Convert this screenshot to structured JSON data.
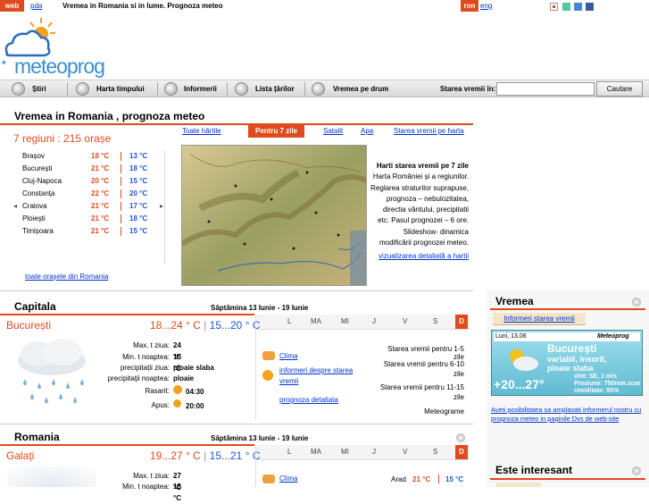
{
  "topbar": {
    "tab_web": "web",
    "tab_pda": "pda",
    "slogan": "Vremea in Romania si in lume. Prognoza meteo",
    "lang_active": "ron",
    "lang_other": "eng",
    "swatch_colors": [
      "#ffffff",
      "#52c7a0",
      "#4a86d8",
      "#345c9c"
    ]
  },
  "logo": {
    "text": "meteoprog"
  },
  "nav": {
    "items": [
      {
        "label": "Știri",
        "icon": "news-icon"
      },
      {
        "label": "Harta timpului",
        "icon": "map-icon"
      },
      {
        "label": "Informerii",
        "icon": "informer-icon"
      },
      {
        "label": "Lista țărilor",
        "icon": "globe-icon"
      },
      {
        "label": "Vremea pe drum",
        "icon": "car-icon"
      }
    ],
    "search_label": "Starea vremii în:",
    "search_value": "",
    "search_button": "Cautare"
  },
  "main": {
    "title": "Vremea in Romania , prognoza meteo",
    "regions": "7 regiuni : 215 orașe",
    "cities": [
      {
        "name": "Brașov",
        "high": "18 °C",
        "low": "13 °C"
      },
      {
        "name": "București",
        "high": "21 °C",
        "low": "18 °C"
      },
      {
        "name": "Cluj-Napoca",
        "high": "20 °C",
        "low": "15 °C"
      },
      {
        "name": "Constanța",
        "high": "22 °C",
        "low": "20 °C"
      },
      {
        "name": "Craiova",
        "high": "21 °C",
        "low": "17 °C"
      },
      {
        "name": "Ploiești",
        "high": "21 °C",
        "low": "18 °C"
      },
      {
        "name": "Timișoara",
        "high": "21 °C",
        "low": "15 °C"
      }
    ],
    "all_cities_link": "toate orașele din Romania",
    "all_maps_link": "Toate hărtile",
    "map_tabs": [
      "Pentru 7 zile",
      "Satalit",
      "Apa",
      "Starea vremii pe harta"
    ],
    "map_desc_title": "Harti starea vremii pe 7 zile",
    "map_desc": "Harta României și a regiunilor. Reglarea straturilor suprapuse, prognoza – nebulozitatea, directia vântului, precipitatii etc. Pasul prognozei – 6 ore. Slideshow- dinamica modificării prognozei meteo.",
    "map_detail_link": "vizualizarea detaliată a hartii"
  },
  "capital": {
    "title": "Capitala",
    "week": "Săptămina 13 Iunie - 19 Iunie",
    "days": [
      "L",
      "MA",
      "MI",
      "J",
      "V",
      "S",
      "D"
    ],
    "city": "București",
    "temp_day": "18...24 ° C",
    "temp_night": "15...20 ° C",
    "stats": [
      {
        "label": "Max. t ziua:",
        "value": "24 °C"
      },
      {
        "label": "Min. t noaptea:",
        "value": "15 °C"
      },
      {
        "label": "precipitații ziua:",
        "value": "ploaie slaba"
      },
      {
        "label": "precipitații noaptea:",
        "value": "ploaie"
      },
      {
        "label": "Rasarit:",
        "value": "04:30"
      },
      {
        "label": "Apus:",
        "value": "20:00"
      }
    ],
    "links": [
      "Clima",
      "informeri despre starea vremii",
      "prognoza detaliata"
    ],
    "right_items": [
      "Starea vremii pentru 1-5 zile",
      "Starea vremii pentru 6-10 zile",
      "Starea vremii pentru 11-15 zile",
      "Meteograme"
    ]
  },
  "romania": {
    "title": "Romania",
    "week": "Săptămina 13 Iunie - 19 Iunie",
    "days": [
      "L",
      "MA",
      "MI",
      "J",
      "V",
      "S",
      "D"
    ],
    "city": "Galați",
    "temp_day": "19...27 ° C",
    "temp_night": "15...21 ° C",
    "stat1_label": "Max. t ziua:",
    "stat1_value": "27 °C",
    "stat2_label": "Min. t noaptea:",
    "stat2_value": "15 °C",
    "link": "Clima",
    "nearby_city": "Arad",
    "nearby_high": "21 °C",
    "nearby_low": "15 °C"
  },
  "sidebar": {
    "title": "Vremea",
    "tab": "Informeri starea vremii",
    "informer_date": "Luni, 13.06",
    "informer_brand": "Meteoprog",
    "informer_city": "București",
    "informer_cond1": "variabil, însorit,",
    "informer_cond2": "ploaie slaba",
    "informer_temp": "+20...27°",
    "informer_wind": "vînt: SE, 1 m/s",
    "informer_pressure": "Presiune: 750mm.scar",
    "informer_humidity": "Umiditate: 55%",
    "informer_link": "Aveti posibilitatea sa amplasati informerul nostru cu prognoza meteo in paginile Dvs de web-site",
    "interest_title": "Este interesant"
  }
}
